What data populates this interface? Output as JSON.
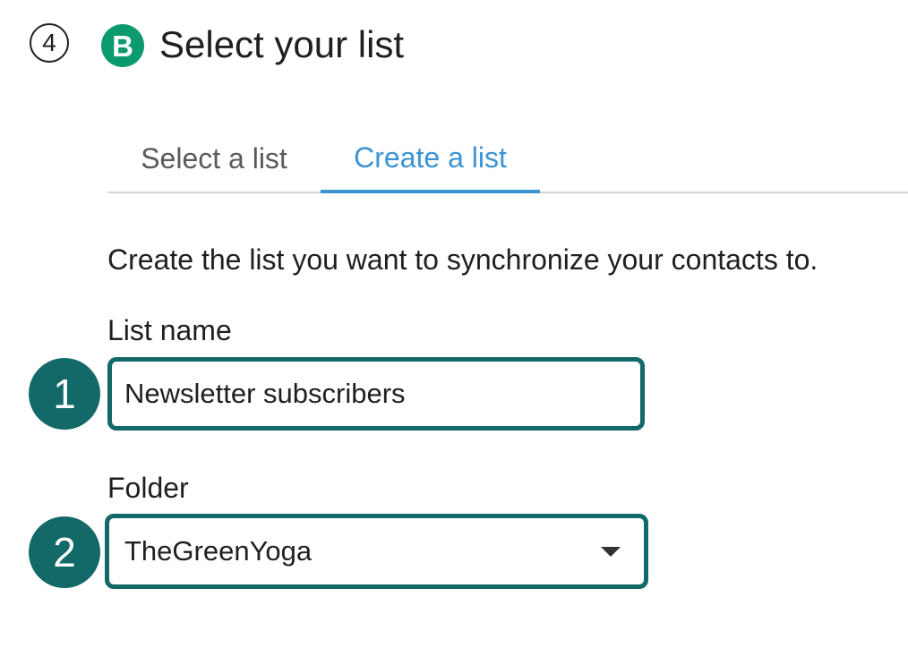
{
  "header": {
    "step_number": "4",
    "brand_letter": "B",
    "brand_color": "#0b996e",
    "title": "Select your list"
  },
  "tabs": [
    {
      "label": "Select a list",
      "active": false
    },
    {
      "label": "Create a list",
      "active": true
    }
  ],
  "tab_accent_color": "#3b94d4",
  "form": {
    "description": "Create the list you want to synchronize your contacts to.",
    "list_name": {
      "label": "List name",
      "value": "Newsletter subscribers"
    },
    "folder": {
      "label": "Folder",
      "selected": "TheGreenYoga"
    }
  },
  "callouts": [
    "1",
    "2"
  ],
  "callout_color": "#136868"
}
